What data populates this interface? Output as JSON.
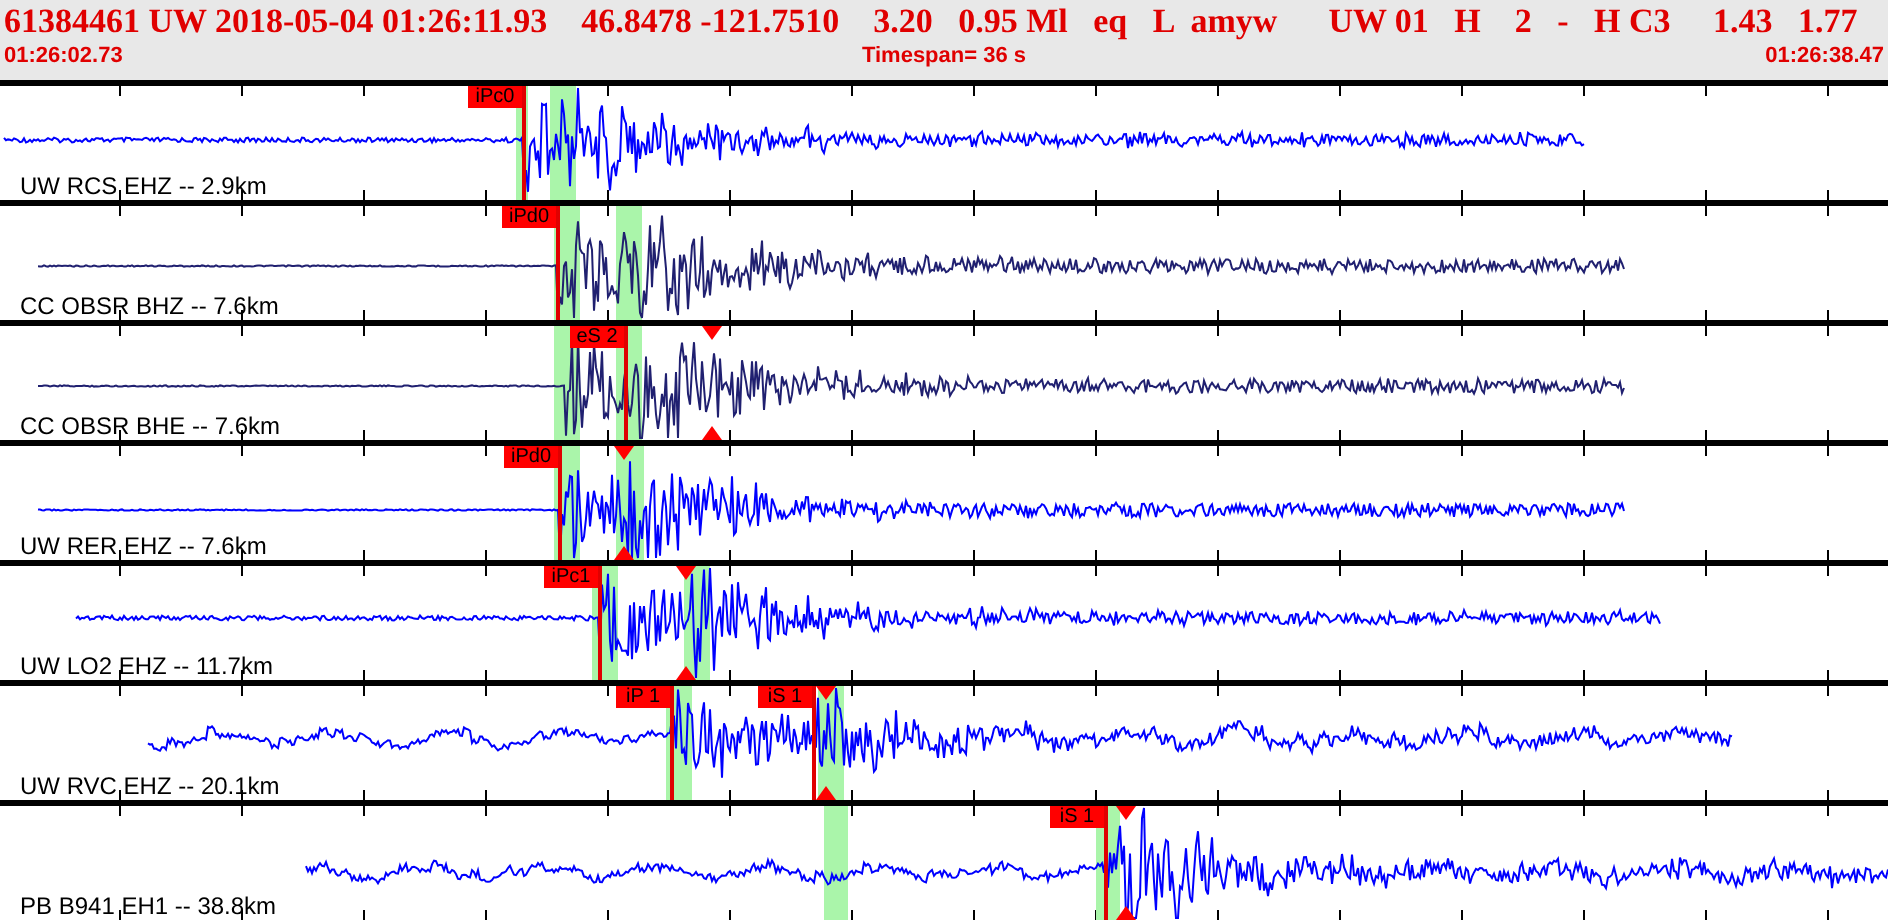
{
  "header": {
    "title": "61384461 UW 2018-05-04 01:26:11.93    46.8478 -121.7510    3.20   0.95 Ml   eq   L  amyw      UW 01   H    2   -   H C3     1.43   1.77",
    "start_time": "01:26:02.73",
    "timespan": "Timespan=  36 s",
    "end_time": "01:26:38.47"
  },
  "traces": [
    {
      "label": "UW RCS EHZ -- 2.9km",
      "color": "#0000ff",
      "picks": [
        {
          "label": "iPc0"
        }
      ]
    },
    {
      "label": "CC OBSR BHZ -- 7.6km",
      "color": "#202070",
      "picks": [
        {
          "label": "iPd0"
        }
      ]
    },
    {
      "label": "CC OBSR BHE -- 7.6km",
      "color": "#202070",
      "picks": [
        {
          "label": "eS 2"
        }
      ]
    },
    {
      "label": "UW RER EHZ -- 7.6km",
      "color": "#0000ff",
      "picks": [
        {
          "label": "iPd0"
        }
      ]
    },
    {
      "label": "UW LO2 EHZ -- 11.7km",
      "color": "#0000ff",
      "picks": [
        {
          "label": "iPc1"
        }
      ]
    },
    {
      "label": "UW RVC EHZ -- 20.1km",
      "color": "#0000ff",
      "picks": [
        {
          "label": "iP 1"
        },
        {
          "label": "iS 1"
        }
      ]
    },
    {
      "label": "PB B941 EH1 -- 38.8km",
      "color": "#0000ff",
      "picks": [
        {
          "label": "iS 1"
        }
      ]
    }
  ]
}
